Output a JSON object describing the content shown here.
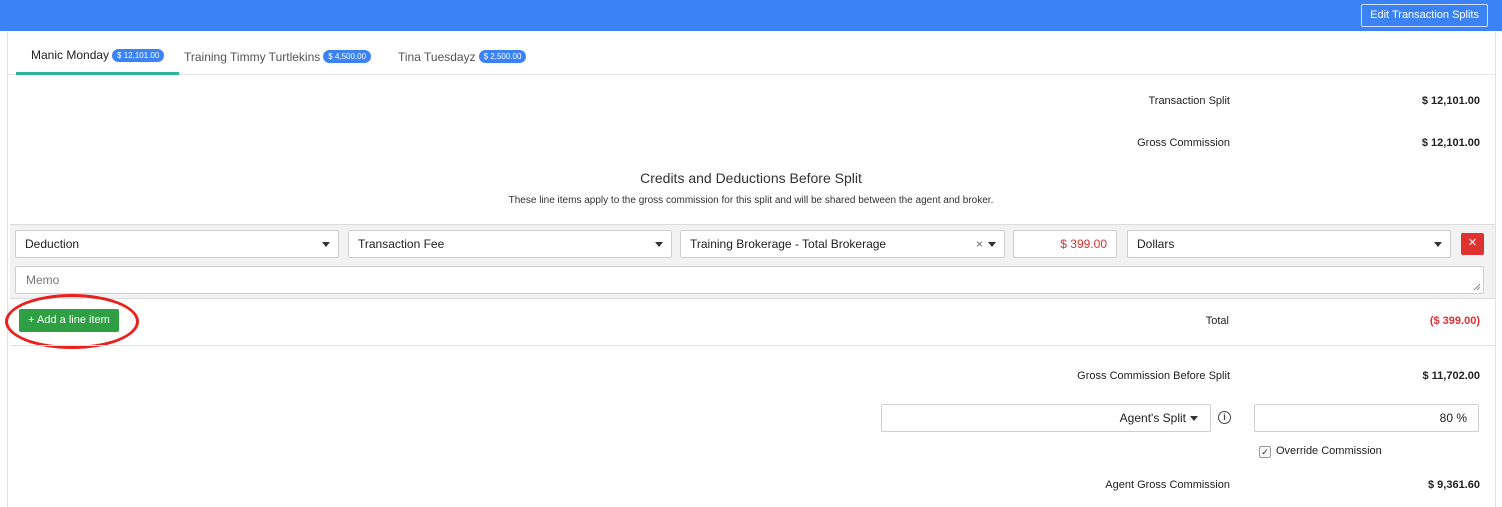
{
  "header": {
    "edit_splits_label": "Edit Transaction Splits"
  },
  "tabs": [
    {
      "label": "Manic Monday",
      "badge": "$ 12,101.00",
      "active": true
    },
    {
      "label": "Training Timmy Turtlekins",
      "badge": "$ 4,500.00",
      "active": false
    },
    {
      "label": "Tina Tuesdayz",
      "badge": "$ 2,500.00",
      "active": false
    }
  ],
  "summary": {
    "transaction_split_label": "Transaction Split",
    "transaction_split_value": "$ 12,101.00",
    "gross_commission_label": "Gross Commission",
    "gross_commission_value": "$ 12,101.00"
  },
  "credits_section": {
    "title": "Credits and Deductions Before Split",
    "subtitle": "These line items apply to the gross commission for this split and will be shared between the agent and broker.",
    "line_item": {
      "type": "Deduction",
      "category": "Transaction Fee",
      "payee": "Training Brokerage - Total Brokerage",
      "amount": "$ 399.00",
      "unit": "Dollars",
      "memo_placeholder": "Memo"
    },
    "add_line_item_label": "+ Add a line item",
    "total_label": "Total",
    "total_value": "($ 399.00)"
  },
  "split": {
    "gross_before_split_label": "Gross Commission Before Split",
    "gross_before_split_value": "$ 11,702.00",
    "split_type": "Agent's Split",
    "split_percent": "80 %",
    "override_label": "Override Commission",
    "override_checked": true,
    "agent_gross_label": "Agent Gross Commission",
    "agent_gross_value": "$ 9,361.60"
  },
  "colors": {
    "topbar": "#3b82f6",
    "tab_active_underline": "#2bb5a0",
    "add_button": "#2ea043",
    "negative": "#e03131",
    "highlight_ring": "#e8211d"
  }
}
